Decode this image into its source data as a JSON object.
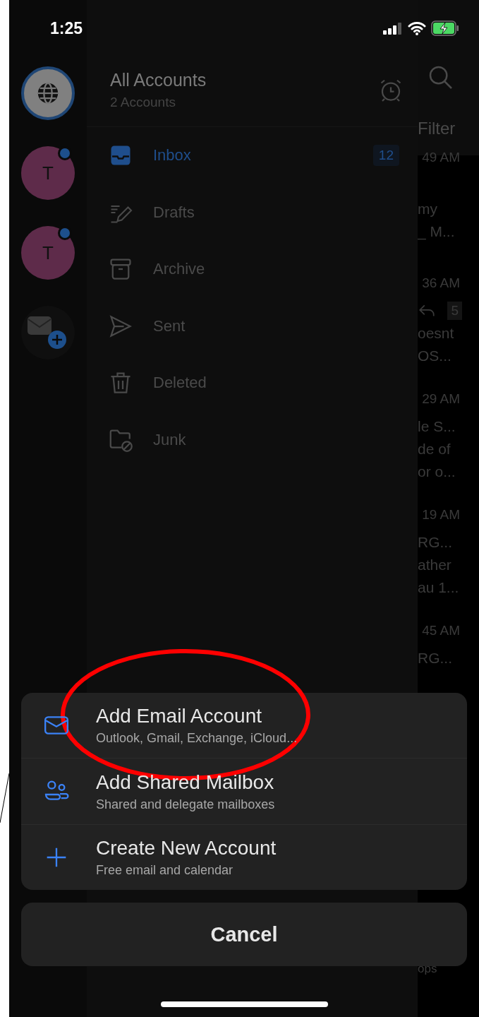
{
  "status_bar": {
    "time": "1:25"
  },
  "accounts": [
    {
      "kind": "all"
    },
    {
      "kind": "person",
      "initial": "T",
      "unread": true
    },
    {
      "kind": "person",
      "initial": "T",
      "unread": true
    },
    {
      "kind": "add"
    }
  ],
  "drawer": {
    "title": "All Accounts",
    "subtitle": "2 Accounts",
    "folders": [
      {
        "kind": "inbox",
        "label": "Inbox",
        "count": "12",
        "selected": true
      },
      {
        "kind": "drafts",
        "label": "Drafts",
        "selected": false
      },
      {
        "kind": "archive",
        "label": "Archive",
        "selected": false
      },
      {
        "kind": "sent",
        "label": "Sent",
        "selected": false
      },
      {
        "kind": "deleted",
        "label": "Deleted",
        "selected": false
      },
      {
        "kind": "junk",
        "label": "Junk",
        "selected": false
      }
    ]
  },
  "message_list": {
    "filter": "Filter",
    "footer": "ops",
    "messages": [
      {
        "time": "49 AM",
        "lines": [
          "my",
          "_ M..."
        ]
      },
      {
        "time": "36 AM",
        "replies": "5",
        "lines": [
          "oesnt",
          "OS..."
        ]
      },
      {
        "time": "29 AM",
        "lines": [
          "le S...",
          "de of",
          "or o..."
        ]
      },
      {
        "time": "19 AM",
        "lines": [
          "RG...",
          "ather",
          "au 1..."
        ]
      },
      {
        "time": "45 AM",
        "lines": [
          "RG..."
        ]
      }
    ]
  },
  "action_sheet": {
    "options": [
      {
        "kind": "mail",
        "title": "Add Email Account",
        "subtitle": "Outlook, Gmail, Exchange, iCloud..."
      },
      {
        "kind": "shared",
        "title": "Add Shared Mailbox",
        "subtitle": "Shared and delegate mailboxes"
      },
      {
        "kind": "create",
        "title": "Create New Account",
        "subtitle": "Free email and calendar"
      }
    ],
    "cancel": "Cancel"
  }
}
